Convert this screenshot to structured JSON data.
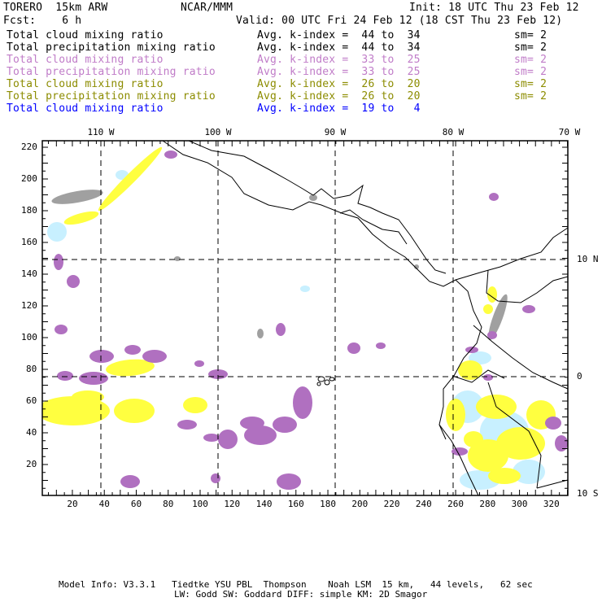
{
  "header": {
    "model": "TORERO  15km ARW",
    "org": "NCAR/MMM",
    "init": "Init: 18 UTC Thu 23 Feb 12",
    "fcst": "Fcst:    6 h",
    "valid": "Valid: 00 UTC Fri 24 Feb 12 (18 CST Thu 23 Feb 12)"
  },
  "legend": [
    {
      "field": "Total cloud mixing ratio",
      "kindex": "Avg. k-index =  44 to  34",
      "sm": "sm= 2",
      "color": "#000000"
    },
    {
      "field": "Total precipitation mixing ratio",
      "kindex": "Avg. k-index =  44 to  34",
      "sm": "sm= 2",
      "color": "#000000"
    },
    {
      "field": "Total cloud mixing ratio",
      "kindex": "Avg. k-index =  33 to  25",
      "sm": "sm= 2",
      "color": "#c07cc8"
    },
    {
      "field": "Total precipitation mixing ratio",
      "kindex": "Avg. k-index =  33 to  25",
      "sm": "sm= 2",
      "color": "#c07cc8"
    },
    {
      "field": "Total cloud mixing ratio",
      "kindex": "Avg. k-index =  26 to  20",
      "sm": "sm= 2",
      "color": "#8c8c00"
    },
    {
      "field": "Total precipitation mixing ratio",
      "kindex": "Avg. k-index =  26 to  20",
      "sm": "sm= 2",
      "color": "#8c8c00"
    },
    {
      "field": "Total cloud mixing ratio",
      "kindex": "Avg. k-index =  19 to   4",
      "sm": "",
      "color": "#0000ff"
    }
  ],
  "fill_colors": {
    "gray": "#a0a0a0",
    "magenta": "#b070c0",
    "yellow": "#ffff40",
    "lightblue": "#c8f0ff"
  },
  "map": {
    "lon_labels": [
      "110 W",
      "100 W",
      "90 W",
      "80 W",
      "70 W"
    ],
    "lat_labels": [
      "10 N",
      "0",
      "10 S"
    ],
    "x_ticks": [
      "20",
      "40",
      "60",
      "80",
      "100",
      "120",
      "140",
      "160",
      "180",
      "200",
      "220",
      "240",
      "260",
      "280",
      "300",
      "320"
    ],
    "y_ticks": [
      "220",
      "200",
      "180",
      "160",
      "140",
      "120",
      "100",
      "80",
      "60",
      "40",
      "20"
    ]
  },
  "footer": {
    "line1": "Model Info: V3.3.1   Tiedtke YSU PBL  Thompson    Noah LSM  15 km,   44 levels,   62 sec",
    "line2": "LW: Godd SW: Goddard DIFF: simple KM: 2D Smagor"
  }
}
